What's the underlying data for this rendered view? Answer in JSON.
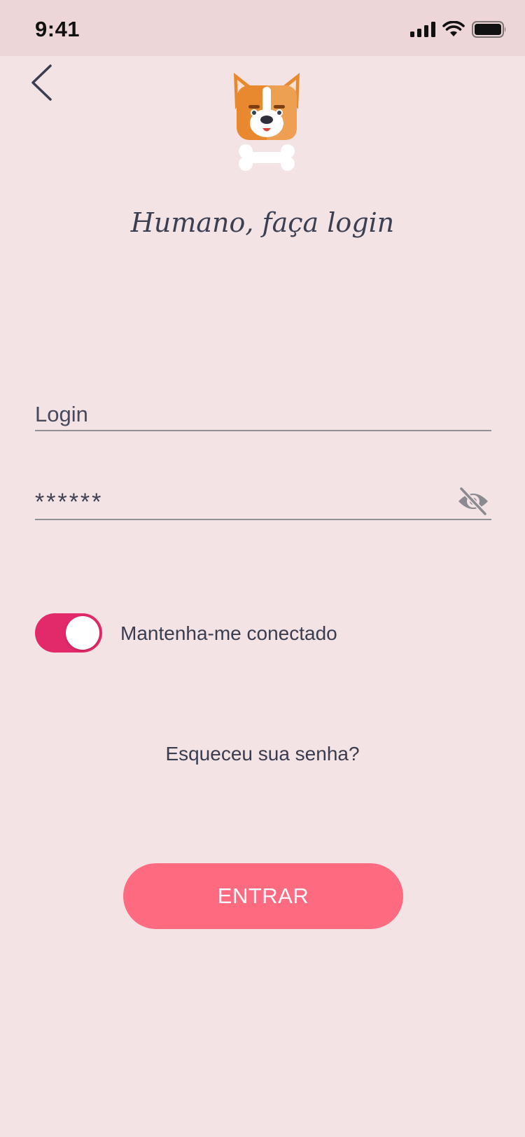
{
  "status_bar": {
    "time": "9:41",
    "icons": [
      "cellular-signal-icon",
      "wifi-icon",
      "battery-icon"
    ]
  },
  "header": {
    "back_icon": "chevron-left-icon",
    "logo_icon": "dog-with-bone-logo"
  },
  "title": "Humano, faça login",
  "form": {
    "login_placeholder": "Login",
    "login_value": "",
    "password_value": "******",
    "password_toggle_icon": "eye-off-icon",
    "remember_me": {
      "label": "Mantenha-me conectado",
      "checked": true
    },
    "forgot_password": "Esqueceu sua senha?",
    "submit_label": "ENTRAR"
  },
  "colors": {
    "background": "#F3E3E4",
    "status_bar": "#EDD6D7",
    "toggle_on": "#E2296A",
    "button": "#FE6A80",
    "text": "#3A3D4F"
  }
}
